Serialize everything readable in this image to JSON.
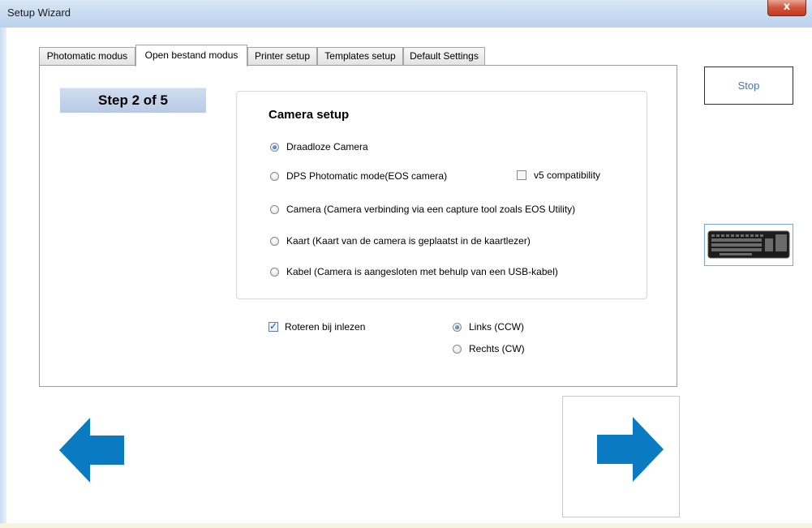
{
  "window": {
    "title": "Setup Wizard",
    "close_glyph": "x"
  },
  "tabs": [
    {
      "label": "Photomatic modus",
      "active": false
    },
    {
      "label": "Open bestand modus",
      "active": true
    },
    {
      "label": "Printer setup",
      "active": false
    },
    {
      "label": "Templates setup",
      "active": false
    },
    {
      "label": "Default Settings",
      "active": false
    }
  ],
  "step": {
    "label": "Step 2 of 5"
  },
  "camera_setup": {
    "title": "Camera setup",
    "options": [
      {
        "label": "Draadloze Camera",
        "selected": true
      },
      {
        "label": "DPS Photomatic mode(EOS camera)",
        "selected": false
      },
      {
        "label": "Camera (Camera verbinding via een capture tool zoals EOS Utility)",
        "selected": false
      },
      {
        "label": "Kaart (Kaart van de camera is geplaatst in de kaartlezer)",
        "selected": false
      },
      {
        "label": "Kabel (Camera is aangesloten met behulp van een USB-kabel)",
        "selected": false
      }
    ],
    "v5_compat": {
      "label": "v5 compatibility",
      "checked": false
    }
  },
  "rotation": {
    "label": "Roteren bij inlezen",
    "checked": true,
    "options": [
      {
        "label": "Links (CCW)",
        "selected": true
      },
      {
        "label": "Rechts (CW)",
        "selected": false
      }
    ]
  },
  "buttons": {
    "stop_label": "Stop",
    "keyboard_icon": "keyboard-icon",
    "back_icon": "arrow-left-icon",
    "next_icon": "arrow-right-icon"
  },
  "colors": {
    "arrow": "#0a7bc2",
    "step_bg": "#c5d4eb",
    "stop_text": "#3a78c9",
    "title_bar": "#c9dcf1"
  }
}
